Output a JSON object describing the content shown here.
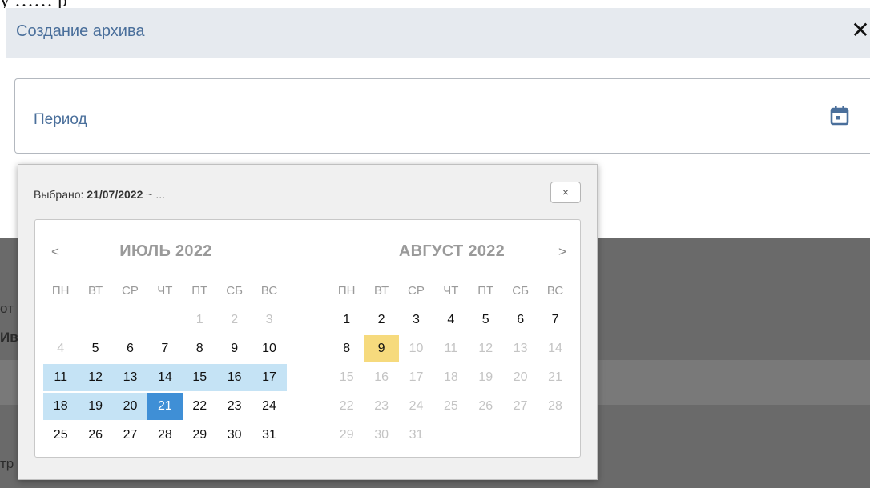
{
  "dialog": {
    "title": "Создание архива",
    "close_icon": "close-icon"
  },
  "period": {
    "label": "Период",
    "icon": "calendar-icon"
  },
  "picker": {
    "selected_prefix": "Выбрано: ",
    "selected_value": "21/07/2022",
    "selected_suffix": " ~ ...",
    "close_glyph": "×",
    "prev_glyph": "<",
    "next_glyph": ">",
    "weekdays": [
      "ПН",
      "ВТ",
      "СР",
      "ЧТ",
      "ПТ",
      "СБ",
      "ВС"
    ],
    "months": [
      {
        "title": "ИЮЛЬ 2022",
        "days": [
          {
            "t": "",
            "s": "empty"
          },
          {
            "t": "",
            "s": "empty"
          },
          {
            "t": "",
            "s": "empty"
          },
          {
            "t": "",
            "s": "empty"
          },
          {
            "t": "1",
            "s": "dis"
          },
          {
            "t": "2",
            "s": "dis"
          },
          {
            "t": "3",
            "s": "dis"
          },
          {
            "t": "4",
            "s": "dis"
          },
          {
            "t": "5",
            "s": ""
          },
          {
            "t": "6",
            "s": ""
          },
          {
            "t": "7",
            "s": ""
          },
          {
            "t": "8",
            "s": ""
          },
          {
            "t": "9",
            "s": ""
          },
          {
            "t": "10",
            "s": ""
          },
          {
            "t": "11",
            "s": "range"
          },
          {
            "t": "12",
            "s": "range"
          },
          {
            "t": "13",
            "s": "range"
          },
          {
            "t": "14",
            "s": "range"
          },
          {
            "t": "15",
            "s": "range"
          },
          {
            "t": "16",
            "s": "range"
          },
          {
            "t": "17",
            "s": "range"
          },
          {
            "t": "18",
            "s": "range"
          },
          {
            "t": "19",
            "s": "range"
          },
          {
            "t": "20",
            "s": "range"
          },
          {
            "t": "21",
            "s": "sel"
          },
          {
            "t": "22",
            "s": ""
          },
          {
            "t": "23",
            "s": ""
          },
          {
            "t": "24",
            "s": ""
          },
          {
            "t": "25",
            "s": ""
          },
          {
            "t": "26",
            "s": ""
          },
          {
            "t": "27",
            "s": ""
          },
          {
            "t": "28",
            "s": ""
          },
          {
            "t": "29",
            "s": ""
          },
          {
            "t": "30",
            "s": ""
          },
          {
            "t": "31",
            "s": ""
          }
        ]
      },
      {
        "title": "АВГУСТ 2022",
        "days": [
          {
            "t": "1",
            "s": ""
          },
          {
            "t": "2",
            "s": ""
          },
          {
            "t": "3",
            "s": ""
          },
          {
            "t": "4",
            "s": ""
          },
          {
            "t": "5",
            "s": ""
          },
          {
            "t": "6",
            "s": ""
          },
          {
            "t": "7",
            "s": ""
          },
          {
            "t": "8",
            "s": ""
          },
          {
            "t": "9",
            "s": "today"
          },
          {
            "t": "10",
            "s": "dis"
          },
          {
            "t": "11",
            "s": "dis"
          },
          {
            "t": "12",
            "s": "dis"
          },
          {
            "t": "13",
            "s": "dis"
          },
          {
            "t": "14",
            "s": "dis"
          },
          {
            "t": "15",
            "s": "dis"
          },
          {
            "t": "16",
            "s": "dis"
          },
          {
            "t": "17",
            "s": "dis"
          },
          {
            "t": "18",
            "s": "dis"
          },
          {
            "t": "19",
            "s": "dis"
          },
          {
            "t": "20",
            "s": "dis"
          },
          {
            "t": "21",
            "s": "dis"
          },
          {
            "t": "22",
            "s": "dis"
          },
          {
            "t": "23",
            "s": "dis"
          },
          {
            "t": "24",
            "s": "dis"
          },
          {
            "t": "25",
            "s": "dis"
          },
          {
            "t": "26",
            "s": "dis"
          },
          {
            "t": "27",
            "s": "dis"
          },
          {
            "t": "28",
            "s": "dis"
          },
          {
            "t": "29",
            "s": "dis"
          },
          {
            "t": "30",
            "s": "dis"
          },
          {
            "t": "31",
            "s": "dis"
          }
        ]
      }
    ]
  },
  "background_fragments": [
    "от",
    "Ив",
    "тр"
  ],
  "colors": {
    "accent_text": "#4a6f9b",
    "header_bg": "#e6eaef",
    "range_bg": "#c5e3f5",
    "selected_bg": "#3f8fd6",
    "today_bg": "#f6da7d",
    "disabled_text": "#c4c4c4"
  }
}
